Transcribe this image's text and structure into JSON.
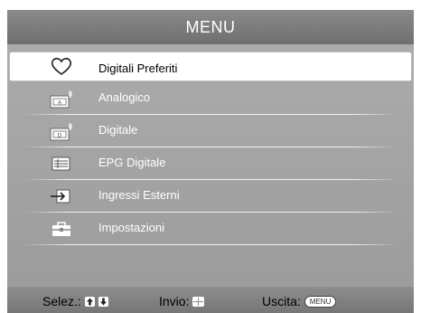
{
  "header": {
    "title": "MENU"
  },
  "menu": {
    "items": [
      {
        "label": "Digitali Preferiti",
        "icon": "heart-icon",
        "selected": true
      },
      {
        "label": "Analogico",
        "icon": "analog-tv-icon"
      },
      {
        "label": "Digitale",
        "icon": "digital-tv-icon"
      },
      {
        "label": "EPG Digitale",
        "icon": "epg-guide-icon"
      },
      {
        "label": "Ingressi Esterni",
        "icon": "external-input-icon"
      },
      {
        "label": "Impostazioni",
        "icon": "toolbox-icon"
      }
    ]
  },
  "footer": {
    "select_label": "Selez.:",
    "enter_label": "Invio:",
    "exit_label": "Uscita:",
    "menu_key": "MENU"
  },
  "colors": {
    "header_bg": "#7d7d7d",
    "panel_bg": "#a3a3a3",
    "selected_bg": "#ffffff"
  }
}
